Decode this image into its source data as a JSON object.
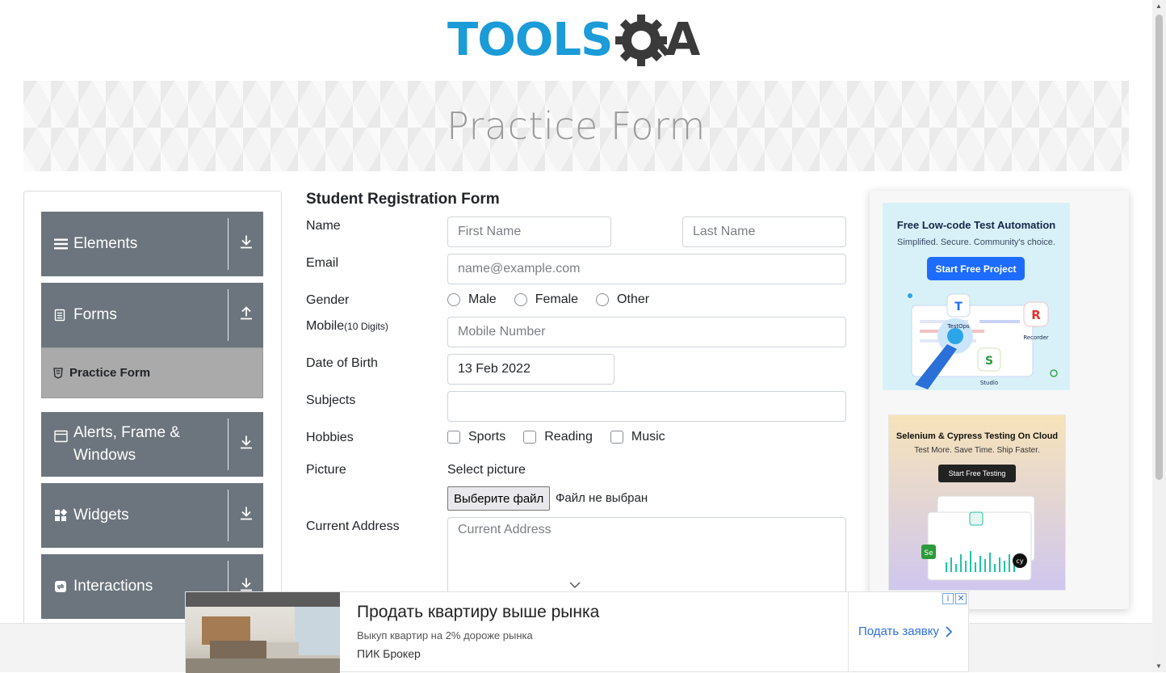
{
  "logo": {
    "text_left": "TOOLS",
    "text_right": "A"
  },
  "banner": {
    "title": "Practice Form"
  },
  "sidebar": {
    "groups": [
      {
        "label": "Elements",
        "icon": "hamburger-icon",
        "arrow": "download-icon"
      },
      {
        "label": "Forms",
        "icon": "document-icon",
        "arrow": "upload-icon"
      },
      {
        "label": "Alerts, Frame & Windows",
        "icon": "window-icon",
        "arrow": "download-icon"
      },
      {
        "label": "Widgets",
        "icon": "widgets-icon",
        "arrow": "download-icon"
      },
      {
        "label": "Interactions",
        "icon": "interactions-icon",
        "arrow": "download-icon"
      }
    ],
    "active_item": {
      "label": "Practice Form",
      "icon": "html5-icon"
    }
  },
  "form": {
    "title": "Student Registration Form",
    "name_label": "Name",
    "first_name_placeholder": "First Name",
    "last_name_placeholder": "Last Name",
    "email_label": "Email",
    "email_placeholder": "name@example.com",
    "gender_label": "Gender",
    "gender_options": [
      "Male",
      "Female",
      "Other"
    ],
    "mobile_label": "Mobile",
    "mobile_hint": "(10 Digits)",
    "mobile_placeholder": "Mobile Number",
    "dob_label": "Date of Birth",
    "dob_value": "13 Feb 2022",
    "subjects_label": "Subjects",
    "subjects_value": "",
    "hobbies_label": "Hobbies",
    "hobbies_options": [
      "Sports",
      "Reading",
      "Music"
    ],
    "picture_label": "Picture",
    "select_picture": "Select picture",
    "file_button": "Выберите файл",
    "file_status": "Файл не выбран",
    "address_label": "Current Address",
    "address_placeholder": "Current Address"
  },
  "ads": {
    "ad1": {
      "title": "Free Low-code Test Automation",
      "subtitle": "Simplified. Secure. Community's choice.",
      "button": "Start Free Project",
      "labels": [
        "TestOps",
        "Recorder",
        "Studio"
      ]
    },
    "ad2": {
      "title": "Selenium & Cypress Testing On Cloud",
      "subtitle": "Test More. Save Time. Ship Faster.",
      "button": "Start Free Testing"
    },
    "bottom": {
      "title": "Продать квартиру выше рынка",
      "subtitle": "Выкуп квартир на 2% дороже рынка",
      "source": "ПИК Брокер",
      "cta": "Подать заявку"
    }
  },
  "colors": {
    "brand_blue": "#1b9bd7",
    "brand_dark": "#4a4a4a",
    "sidebar_bg": "#6c757d",
    "active_bg": "#aaaaaa"
  }
}
